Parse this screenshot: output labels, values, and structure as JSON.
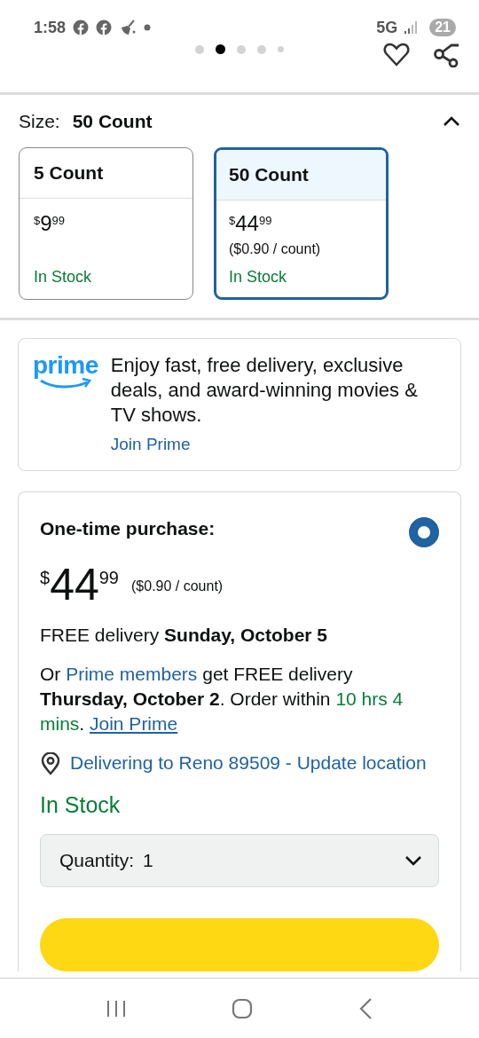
{
  "status_bar": {
    "time": "1:58",
    "network": "5G",
    "battery": "21"
  },
  "carousel": {
    "dots": [
      {
        "selected": false
      },
      {
        "selected": true
      },
      {
        "selected": false
      },
      {
        "selected": false
      },
      {
        "selected": false
      }
    ]
  },
  "size": {
    "label": "Size:",
    "value": "50 Count",
    "expanded": true,
    "options": [
      {
        "name": "5 Count",
        "price": {
          "symbol": "$",
          "whole": "9",
          "fraction": "99"
        },
        "availability": "In Stock",
        "selected": false
      },
      {
        "name": "50 Count",
        "price": {
          "symbol": "$",
          "whole": "44",
          "fraction": "99"
        },
        "unit_price": "($0.90 / count)",
        "availability": "In Stock",
        "selected": true
      }
    ]
  },
  "prime": {
    "logo": "prime",
    "text": "Enjoy fast, free delivery, exclusive deals, and award-winning movies & TV shows.",
    "link": "Join Prime"
  },
  "purchase": {
    "title": "One-time purchase:",
    "selected": true,
    "price": {
      "symbol": "$",
      "whole": "44",
      "fraction": "99"
    },
    "unit_price": "($0.90 / count)",
    "delivery": "FREE delivery **Sunday, October 5**",
    "prime_delivery": [
      {
        "kind": "text",
        "text": "Or "
      },
      {
        "kind": "link",
        "text": "Prime members"
      },
      {
        "kind": "text",
        "text": " get FREE delivery "
      },
      {
        "kind": "bold",
        "text": "Thursday, October 2"
      },
      {
        "kind": "text",
        "text": ". Order within "
      },
      {
        "kind": "countdown",
        "text": "10 hrs 4 mins"
      },
      {
        "kind": "text",
        "text": ". "
      },
      {
        "kind": "underlined_link",
        "text": "Join Prime"
      }
    ],
    "location": "Delivering to Reno 89509 - Update location",
    "availability": "In Stock",
    "quantity": {
      "label": "Quantity:",
      "value": "1"
    },
    "actions": [
      {
        "kind": "add_to_cart"
      }
    ]
  }
}
